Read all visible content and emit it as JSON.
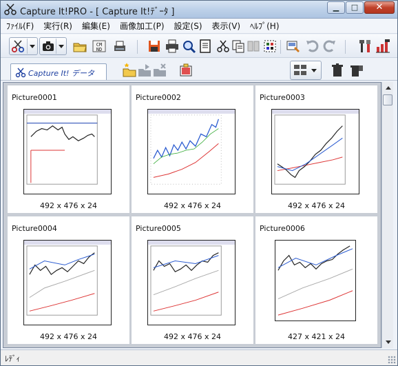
{
  "window": {
    "title": "Capture It!PRO - [ Capture It!ﾃﾞｰﾀ ]"
  },
  "menu": [
    "ﾌｧｲﾙ(F)",
    "実行(R)",
    "編集(E)",
    "画像加工(P)",
    "設定(S)",
    "表示(V)",
    "ﾍﾙﾌﾟ(H)"
  ],
  "tab": {
    "label": "Capture It! データ"
  },
  "pictures": [
    {
      "name": "Picture0001",
      "dims": "492 x 476 x 24"
    },
    {
      "name": "Picture0002",
      "dims": "492 x 476 x 24"
    },
    {
      "name": "Picture0003",
      "dims": "492 x 476 x 24"
    },
    {
      "name": "Picture0004",
      "dims": "492 x 476 x 24"
    },
    {
      "name": "Picture0005",
      "dims": "492 x 476 x 24"
    },
    {
      "name": "Picture0006",
      "dims": "427 x 421 x 24"
    }
  ],
  "status": {
    "text": "ﾚﾃﾞｨ"
  },
  "colors": {
    "accent": "#1d3fa0",
    "title_gradient": "#bcd0e8",
    "close": "#c0412a"
  }
}
